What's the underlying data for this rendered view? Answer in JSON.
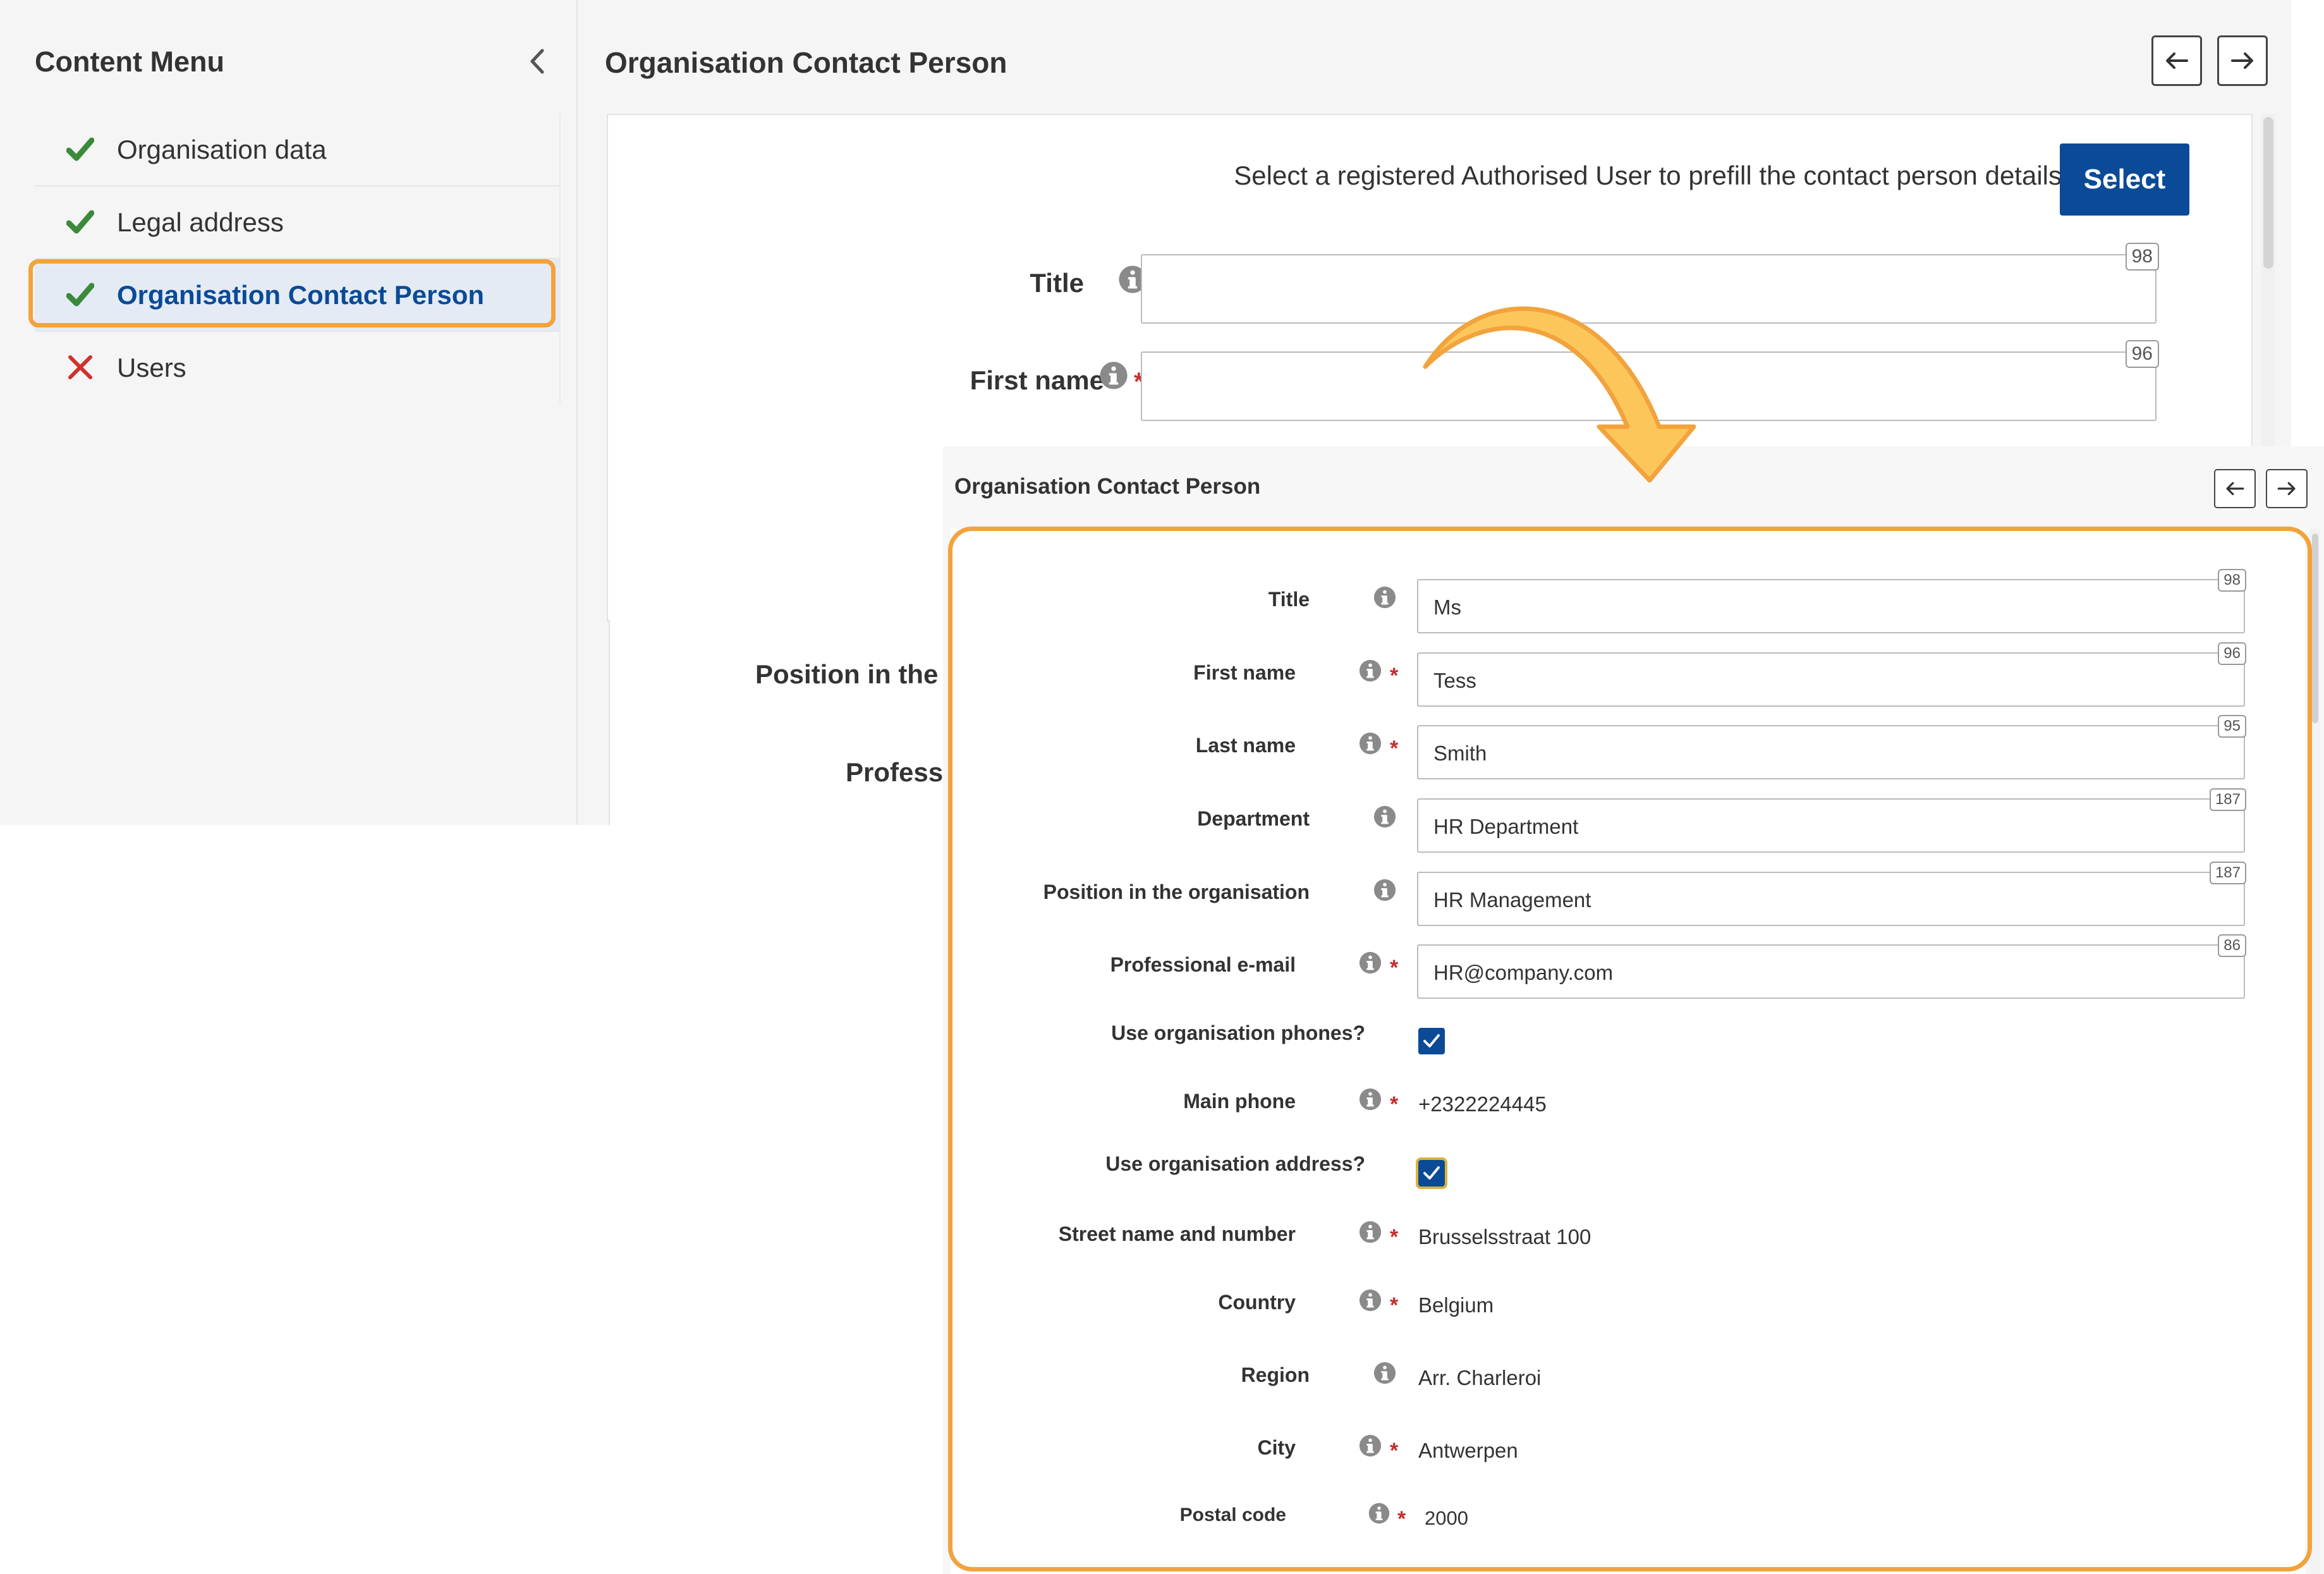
{
  "sidebar": {
    "title": "Content Menu",
    "items": [
      {
        "label": "Organisation data",
        "status": "complete"
      },
      {
        "label": "Legal address",
        "status": "complete"
      },
      {
        "label": "Organisation Contact Person",
        "status": "complete",
        "active": true
      },
      {
        "label": "Users",
        "status": "incomplete"
      }
    ]
  },
  "back_page": {
    "title": "Organisation Contact Person",
    "prefill_text": "Select a registered Authorised User to prefill the contact person details",
    "select_label": "Select",
    "fields": [
      {
        "label": "Title",
        "counter": "98",
        "required": false
      },
      {
        "label": "First name",
        "counter": "96",
        "required": true
      }
    ],
    "lower_labels": [
      "Position in the o",
      "Professi"
    ]
  },
  "front_page": {
    "title": "Organisation Contact Person",
    "fields": {
      "title": {
        "label": "Title",
        "value": "Ms",
        "counter": "98"
      },
      "first_name": {
        "label": "First name",
        "value": "Tess",
        "counter": "96"
      },
      "last_name": {
        "label": "Last name",
        "value": "Smith",
        "counter": "95"
      },
      "department": {
        "label": "Department",
        "value": "HR Department",
        "counter": "187"
      },
      "position": {
        "label": "Position in the organisation",
        "value": "HR Management",
        "counter": "187"
      },
      "email": {
        "label": "Professional e-mail",
        "value": "HR@company.com",
        "counter": "86"
      },
      "use_org_phones": {
        "label": "Use organisation phones?",
        "checked": true
      },
      "main_phone": {
        "label": "Main phone",
        "value": "+2322224445"
      },
      "use_org_address": {
        "label": "Use organisation address?",
        "checked": true
      },
      "street": {
        "label": "Street name and number",
        "value": "Brusselsstraat 100"
      },
      "country": {
        "label": "Country",
        "value": "Belgium"
      },
      "region": {
        "label": "Region",
        "value": "Arr. Charleroi"
      },
      "city": {
        "label": "City",
        "value": "Antwerpen"
      },
      "postal_code": {
        "label": "Postal code",
        "value": "2000"
      }
    }
  },
  "colors": {
    "accent": "#0b4a96",
    "highlight": "#f2a33c",
    "check_green": "#3a8a3a",
    "error_red": "#d0312d",
    "required_red": "#c82c2c"
  },
  "icons": {
    "complete": "check-icon",
    "incomplete": "cross-icon",
    "info": "info-icon",
    "collapse": "chevron-left-icon",
    "prev": "arrow-left-icon",
    "next": "arrow-right-icon"
  }
}
